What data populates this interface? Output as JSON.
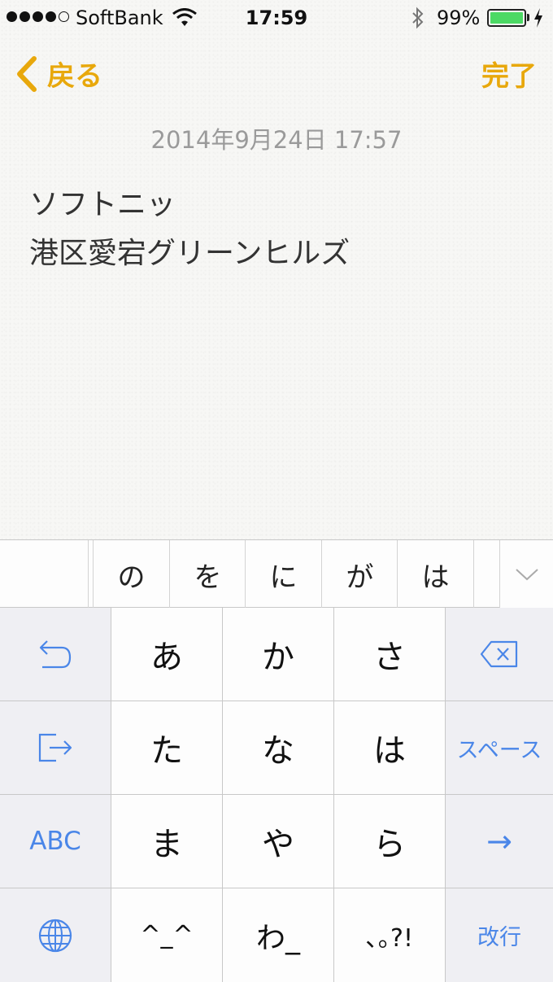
{
  "status_bar": {
    "carrier": "SoftBank",
    "time": "17:59",
    "battery_percent": "99%",
    "battery_level": 0.99,
    "signal_bars": 4,
    "signal_total": 5,
    "icons": [
      "wifi-icon",
      "bluetooth-icon",
      "battery-icon",
      "charging-icon"
    ]
  },
  "nav": {
    "back_label": "戻る",
    "done_label": "完了"
  },
  "note": {
    "date": "2014年9月24日 17:57",
    "lines": [
      "ソフトニッ",
      "港区愛宕グリーンヒルズ"
    ]
  },
  "candidates": [
    "の",
    "を",
    "に",
    "が",
    "は"
  ],
  "keyboard": {
    "rows": [
      [
        "undo-icon",
        "あ",
        "か",
        "さ",
        "delete-icon"
      ],
      [
        "next-input-icon",
        "た",
        "な",
        "は",
        "スペース"
      ],
      [
        "ABC",
        "ま",
        "や",
        "ら",
        "→"
      ],
      [
        "globe-icon",
        "^_^",
        "わ_",
        "､｡?!",
        "改行"
      ]
    ]
  },
  "colors": {
    "accent": "#e8a80c",
    "key_blue": "#4a86e8",
    "battery_green": "#4cd964"
  }
}
